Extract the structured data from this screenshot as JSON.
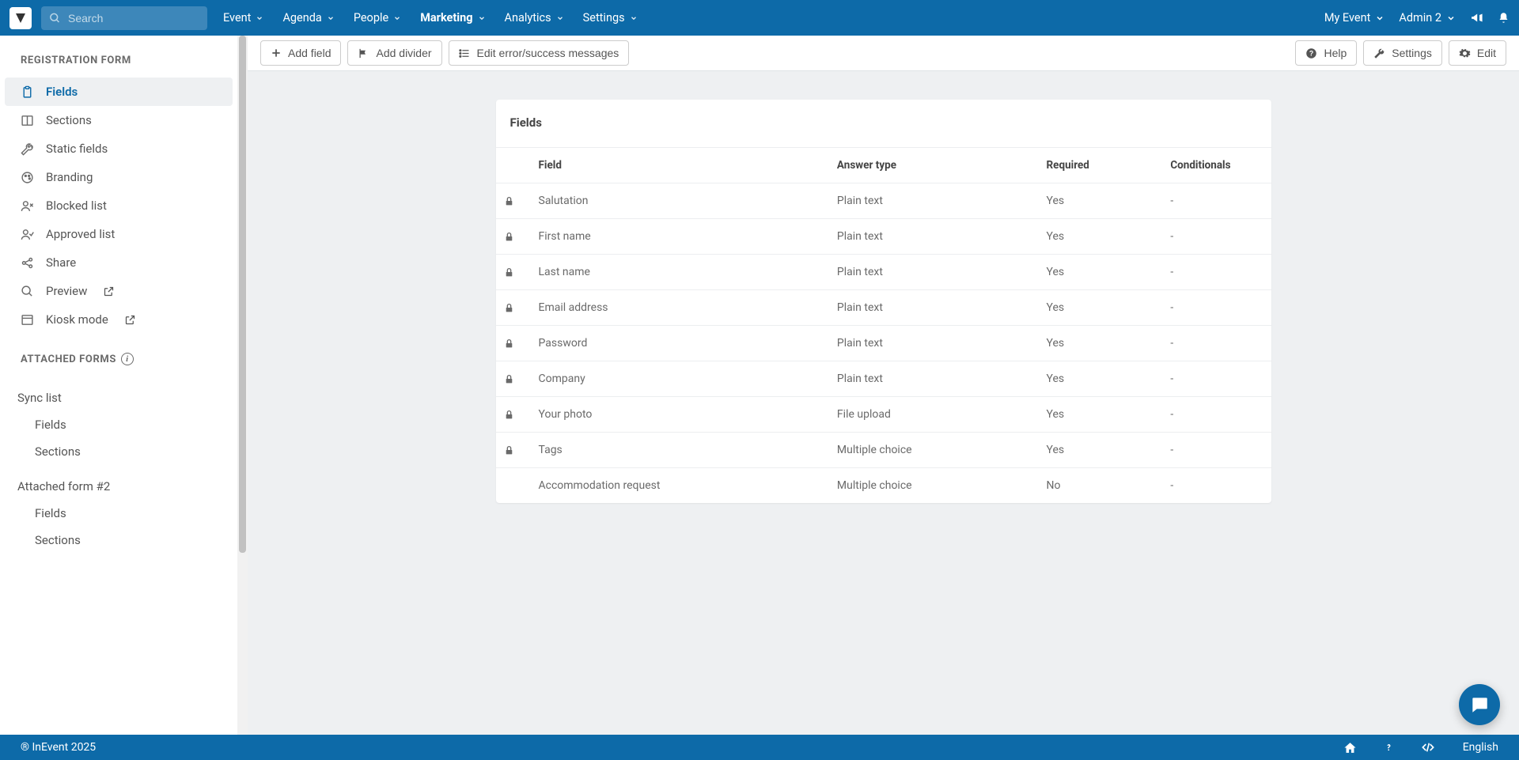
{
  "brand_name": "InEvent",
  "search": {
    "placeholder": "Search"
  },
  "topnav": {
    "items": [
      {
        "label": "Event"
      },
      {
        "label": "Agenda"
      },
      {
        "label": "People"
      },
      {
        "label": "Marketing",
        "active": true
      },
      {
        "label": "Analytics"
      },
      {
        "label": "Settings"
      }
    ],
    "event_selector": "My Event",
    "user_selector": "Admin 2"
  },
  "sidebar": {
    "section1_title": "REGISTRATION FORM",
    "section2_title": "ATTACHED FORMS",
    "items": [
      {
        "label": "Fields",
        "icon": "clipboard",
        "active": true
      },
      {
        "label": "Sections",
        "icon": "columns"
      },
      {
        "label": "Static fields",
        "icon": "wrench"
      },
      {
        "label": "Branding",
        "icon": "palette"
      },
      {
        "label": "Blocked list",
        "icon": "user-x"
      },
      {
        "label": "Approved list",
        "icon": "user-check"
      },
      {
        "label": "Share",
        "icon": "share"
      },
      {
        "label": "Preview",
        "icon": "search",
        "external": true
      },
      {
        "label": "Kiosk mode",
        "icon": "window",
        "external": true
      }
    ],
    "attached": [
      {
        "heading": "Sync list",
        "children": [
          "Fields",
          "Sections"
        ]
      },
      {
        "heading": "Attached form #2",
        "children": [
          "Fields",
          "Sections"
        ]
      }
    ]
  },
  "toolbar": {
    "add_field": "Add field",
    "add_divider": "Add divider",
    "edit_messages": "Edit error/success messages",
    "help": "Help",
    "settings": "Settings",
    "edit": "Edit"
  },
  "card": {
    "title": "Fields",
    "columns": {
      "field": "Field",
      "answer_type": "Answer type",
      "required": "Required",
      "conditionals": "Conditionals"
    },
    "rows": [
      {
        "locked": true,
        "field": "Salutation",
        "answer_type": "Plain text",
        "required": "Yes",
        "conditionals": "-"
      },
      {
        "locked": true,
        "field": "First name",
        "answer_type": "Plain text",
        "required": "Yes",
        "conditionals": "-"
      },
      {
        "locked": true,
        "field": "Last name",
        "answer_type": "Plain text",
        "required": "Yes",
        "conditionals": "-"
      },
      {
        "locked": true,
        "field": "Email address",
        "answer_type": "Plain text",
        "required": "Yes",
        "conditionals": "-"
      },
      {
        "locked": true,
        "field": "Password",
        "answer_type": "Plain text",
        "required": "Yes",
        "conditionals": "-"
      },
      {
        "locked": true,
        "field": "Company",
        "answer_type": "Plain text",
        "required": "Yes",
        "conditionals": "-"
      },
      {
        "locked": true,
        "field": "Your photo",
        "answer_type": "File upload",
        "required": "Yes",
        "conditionals": "-"
      },
      {
        "locked": true,
        "field": "Tags",
        "answer_type": "Multiple choice",
        "required": "Yes",
        "conditionals": "-"
      },
      {
        "locked": false,
        "field": "Accommodation request",
        "answer_type": "Multiple choice",
        "required": "No",
        "conditionals": "-"
      }
    ]
  },
  "footer": {
    "copyright": "® InEvent 2025",
    "language": "English"
  }
}
